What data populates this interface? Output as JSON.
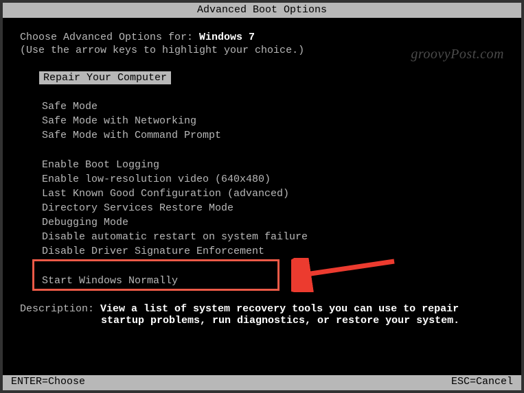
{
  "title_bar": "Advanced Boot Options",
  "intro": {
    "prefix": "Choose Advanced Options for: ",
    "os_name": "Windows 7"
  },
  "instruction": "(Use the arrow keys to highlight your choice.)",
  "selected": "Repair Your Computer",
  "groups": [
    [
      "Safe Mode",
      "Safe Mode with Networking",
      "Safe Mode with Command Prompt"
    ],
    [
      "Enable Boot Logging",
      "Enable low-resolution video (640x480)",
      "Last Known Good Configuration (advanced)",
      "Directory Services Restore Mode",
      "Debugging Mode",
      "Disable automatic restart on system failure",
      "Disable Driver Signature Enforcement"
    ],
    [
      "Start Windows Normally"
    ]
  ],
  "description": {
    "label": "Description: ",
    "text_line1": "View a list of system recovery tools you can use to repair",
    "text_line2": "startup problems, run diagnostics, or restore your system."
  },
  "bottom": {
    "left": "ENTER=Choose",
    "right": "ESC=Cancel"
  },
  "watermark": "groovyPost.com"
}
